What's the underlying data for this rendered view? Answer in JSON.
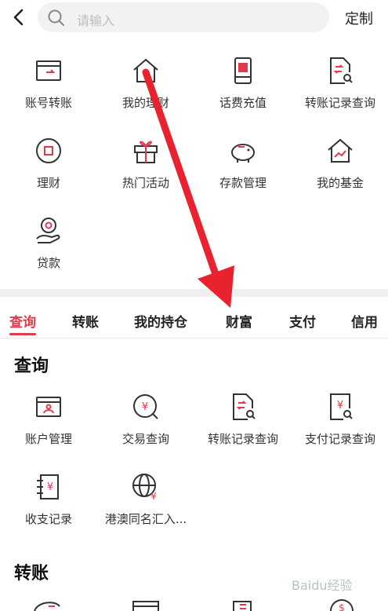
{
  "header": {
    "search_placeholder": "请输入",
    "custom_label": "定制"
  },
  "quick_items": [
    {
      "label": "账号转账",
      "icon": "transfer-card-icon"
    },
    {
      "label": "我的理财",
      "icon": "wealth-house-icon"
    },
    {
      "label": "话费充值",
      "icon": "phone-recharge-icon"
    },
    {
      "label": "转账记录查询",
      "icon": "transfer-record-icon"
    },
    {
      "label": "理财",
      "icon": "finance-circle-icon"
    },
    {
      "label": "热门活动",
      "icon": "gift-icon"
    },
    {
      "label": "存款管理",
      "icon": "piggy-bank-icon"
    },
    {
      "label": "我的基金",
      "icon": "fund-house-icon"
    },
    {
      "label": "贷款",
      "icon": "loan-hand-icon"
    }
  ],
  "tabs": [
    {
      "label": "查询",
      "active": true
    },
    {
      "label": "转账",
      "active": false
    },
    {
      "label": "我的持仓",
      "active": false
    },
    {
      "label": "财富",
      "active": false
    },
    {
      "label": "支付",
      "active": false
    },
    {
      "label": "信用",
      "active": false
    }
  ],
  "query_section": {
    "title": "查询",
    "items": [
      {
        "label": "账户管理",
        "icon": "account-card-icon"
      },
      {
        "label": "交易查询",
        "icon": "trade-search-icon"
      },
      {
        "label": "转账记录查询",
        "icon": "transfer-record-icon"
      },
      {
        "label": "支付记录查询",
        "icon": "payment-record-icon"
      },
      {
        "label": "收支记录",
        "icon": "income-record-icon"
      },
      {
        "label": "港澳同名汇入...",
        "icon": "globe-yen-icon"
      }
    ]
  },
  "transfer_section": {
    "title": "转账"
  },
  "accent_color": "#e03a4d",
  "watermark": "Baidu经验"
}
